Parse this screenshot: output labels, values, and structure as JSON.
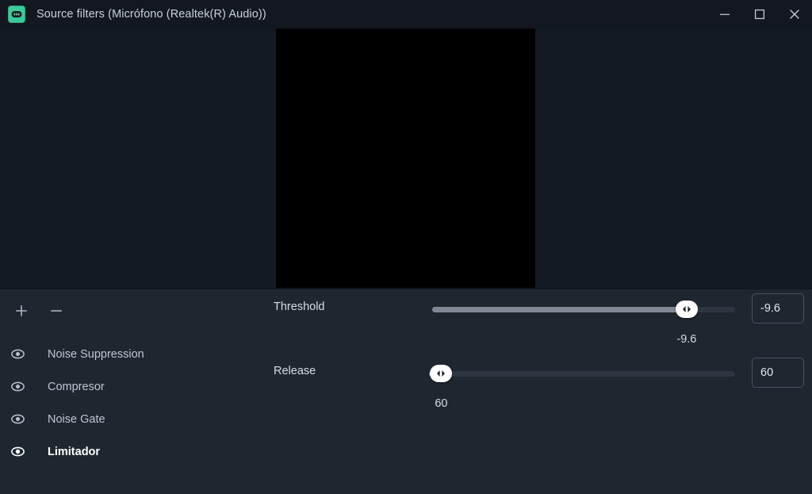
{
  "window": {
    "title": "Source filters (Micrófono (Realtek(R) Audio))",
    "app_icon": "obs-logo-icon",
    "controls": {
      "minimize": "minimize-icon",
      "maximize": "maximize-icon",
      "close": "close-icon"
    },
    "accent_color": "#3bcb9b",
    "titlebar_bg": "#121720",
    "body_bg": "#1e2630"
  },
  "preview": {
    "canvas_color": "#000000",
    "background_color": "#131a23"
  },
  "sidebar": {
    "toolbar": [
      {
        "name": "add-filter-button",
        "icon": "plus-icon",
        "label": "+"
      },
      {
        "name": "remove-filter-button",
        "icon": "minus-icon",
        "label": "−"
      }
    ],
    "filters": [
      {
        "label": "Noise Suppression",
        "visible": true,
        "selected": false
      },
      {
        "label": "Compresor",
        "visible": true,
        "selected": false
      },
      {
        "label": "Noise Gate",
        "visible": true,
        "selected": false
      },
      {
        "label": "Limitador",
        "visible": true,
        "selected": true
      }
    ]
  },
  "properties": [
    {
      "name": "threshold",
      "label": "Threshold",
      "value": "-9.6",
      "value_number": -9.6,
      "min": -60,
      "max": 0,
      "percent": 84,
      "spinbox_value": "-9.6"
    },
    {
      "name": "release",
      "label": "Release",
      "value": "60",
      "value_number": 60,
      "min": 1,
      "max": 1000,
      "percent": 5,
      "spinbox_value": "60"
    }
  ]
}
